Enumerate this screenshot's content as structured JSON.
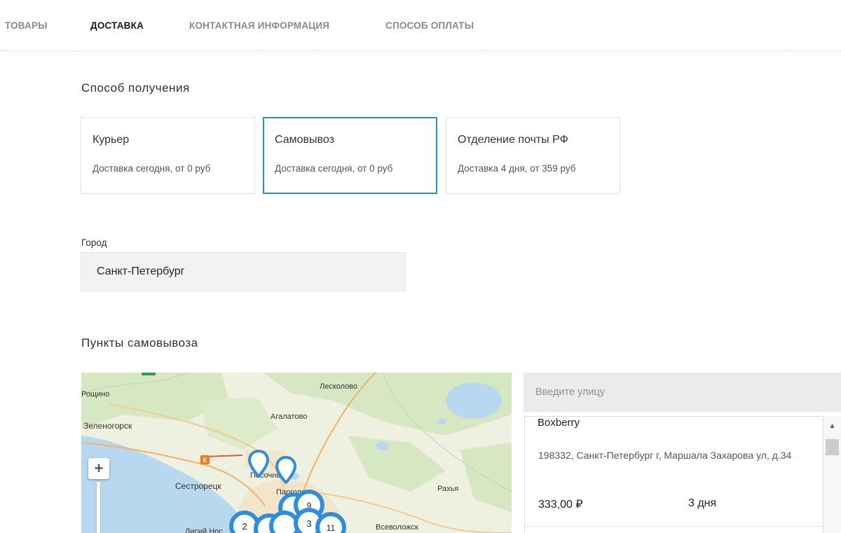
{
  "tabs": [
    {
      "label": "Товары",
      "active": false
    },
    {
      "label": "Доставка",
      "active": true
    },
    {
      "label": "Контактная информация",
      "active": false
    },
    {
      "label": "Способ оплаты",
      "active": false
    }
  ],
  "delivery": {
    "heading": "Способ получения",
    "methods": [
      {
        "title": "Курьер",
        "subtitle": "Доставка сегодня, от 0 руб",
        "selected": false
      },
      {
        "title": "Самовывоз",
        "subtitle": "Доставка сегодня, от 0 руб",
        "selected": true
      },
      {
        "title": "Отделение почты РФ",
        "subtitle": "Доставка 4 дня, от 359 руб",
        "selected": false
      }
    ]
  },
  "city": {
    "label": "Город",
    "value": "Санкт-Петербург"
  },
  "pickup": {
    "heading": "Пункты самовывоза",
    "search_placeholder": "Введите улицу",
    "points": [
      {
        "name": "Boxberry",
        "address": "198332, Санкт-Петербург г, Маршала Захарова ул, д.34",
        "price": "333,00 ₽",
        "days": "3 дня"
      }
    ]
  },
  "map": {
    "zoom_in_label": "+",
    "labels": {
      "leskolovo": "Лесколово",
      "roshchino": "Рощино",
      "agalatovo": "Агалатово",
      "zelenogorsk": "Зеленогорск",
      "sestroretsk": "Сестрорецк",
      "pesochny": "Песочный",
      "pargolovo": "Парголово",
      "rakhya": "Рахья",
      "vsevolozhsk": "Всеволожск",
      "lisy_nos": "Лисий Нос"
    },
    "cluster_counts": {
      "c1": "2",
      "c2": "3",
      "c3": "11",
      "c4": "9"
    },
    "colors": {
      "water": "#b8d8ef",
      "land": "#eef1e0",
      "forest": "#d6e8c2",
      "marker": "#2a8fe0"
    }
  },
  "colors": {
    "accent": "#2b8fc9"
  }
}
